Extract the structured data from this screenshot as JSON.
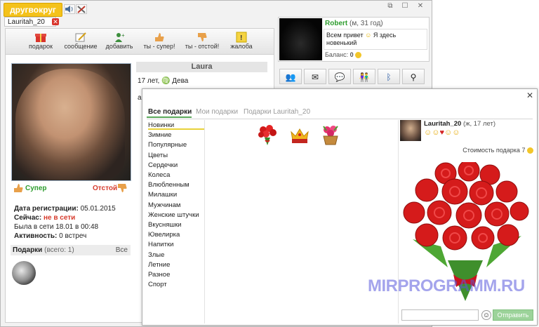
{
  "app": {
    "logo": "другвокруг",
    "minimize": "⧉",
    "maximize": "☐",
    "close": "✕"
  },
  "profile_tab": {
    "label": "Lauritah_20",
    "close": "✕"
  },
  "toolbar": {
    "gift_label": "подарок",
    "message_label": "сообщение",
    "add_label": "добавить",
    "cool_label": "ты - супер!",
    "bad_label": "ты - отстой!",
    "complain_label": "жалоба"
  },
  "profile": {
    "name": "Laura",
    "age_line": "17 лет,",
    "zodiac": "Дева",
    "vote_super": "Супер",
    "vote_bad": "Отстой",
    "reg_label": "Дата регистрации:",
    "reg_value": "05.01.2015",
    "now_label": "Сейчас:",
    "now_value": "не в сети",
    "last_seen": "Была в сети 18.01 в 00:48",
    "activity_label": "Активность:",
    "activity_value": "0 встреч",
    "gifts_label": "Подарки",
    "gifts_count": "(всего: 1)",
    "gifts_all": "Все",
    "letter_fragment": "al"
  },
  "user_card": {
    "name": "Robert",
    "meta": "(м, 31 год)",
    "status_line1": "Всем привет",
    "status_line1_after": "Я здесь",
    "status_line2": "новенький",
    "balance_label": "Баланс:",
    "balance_value": "0"
  },
  "dialog": {
    "tab_all": "Все подарки",
    "tab_mine": "Мои подарки",
    "tab_user": "Подарки Lauritah_20",
    "categories": [
      "Новинки",
      "Зимние",
      "Популярные",
      "Цветы",
      "Сердечки",
      "Колеса",
      "Влюбленным",
      "Милашки",
      "Мужчинам",
      "Женские штучки",
      "Вкусняшки",
      "Ювелирка",
      "Напитки",
      "Злые",
      "Летние",
      "Разное",
      "Спорт"
    ],
    "recipient_name": "Lauritah_20",
    "recipient_meta": "(ж, 17 лет)",
    "price_label": "Стоимость подарка",
    "price_value": "7",
    "send_label": "Отправить",
    "message_placeholder": ""
  },
  "watermark": "MIRPROGRAMM.RU",
  "colors": {
    "logo_bg": "#f4c21b",
    "super_green": "#2e9d2e",
    "bad_red": "#d63a2b",
    "send_green": "#9cd39a",
    "offline_red": "#d63a2b",
    "accent_green": "#5aa95a"
  }
}
